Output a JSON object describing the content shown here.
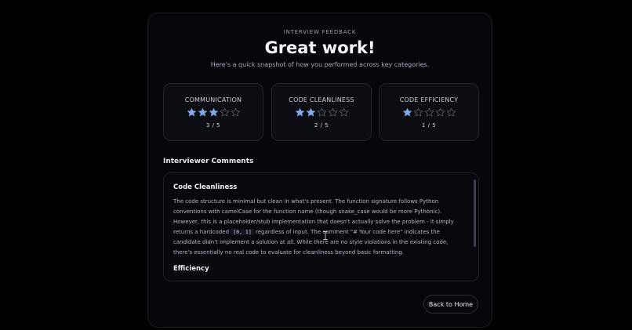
{
  "header": {
    "eyebrow": "INTERVIEW FEEDBACK",
    "title": "Great work!",
    "subtitle": "Here's a quick snapshot of how you performed across key categories."
  },
  "metrics": [
    {
      "label": "COMMUNICATION",
      "rating": 3,
      "max": 5,
      "score_text": "3 / 5"
    },
    {
      "label": "CODE CLEANLINESS",
      "rating": 2,
      "max": 5,
      "score_text": "2 / 5"
    },
    {
      "label": "CODE EFFICIENCY",
      "rating": 1,
      "max": 5,
      "score_text": "1 / 5"
    }
  ],
  "comments": {
    "heading": "Interviewer Comments",
    "sections": [
      {
        "title": "Code Cleanliness",
        "body_before_code": "The code structure is minimal but clean in what's present. The function signature follows Python conventions with camelCase for the function name (though snake_case would be more Pythonic). However, this is a placeholder/stub implementation that doesn't actually solve the problem - it simply returns a hardcoded ",
        "code": "[0, 1]",
        "body_after_code": " regardless of input. The comment \"# Your code here\" indicates the candidate didn't implement a solution at all. While there are no style violations in the existing code, there's essentially no real code to evaluate for cleanliness beyond basic formatting."
      },
      {
        "title": "Efficiency",
        "body": ""
      }
    ]
  },
  "actions": {
    "back_label": "Back to Home"
  },
  "colors": {
    "star_filled": "#7fa8e6",
    "star_empty": "#5a5f6b"
  },
  "icons": {
    "rating_icon": "star-icon",
    "cursor_icon": "text-cursor-icon"
  }
}
